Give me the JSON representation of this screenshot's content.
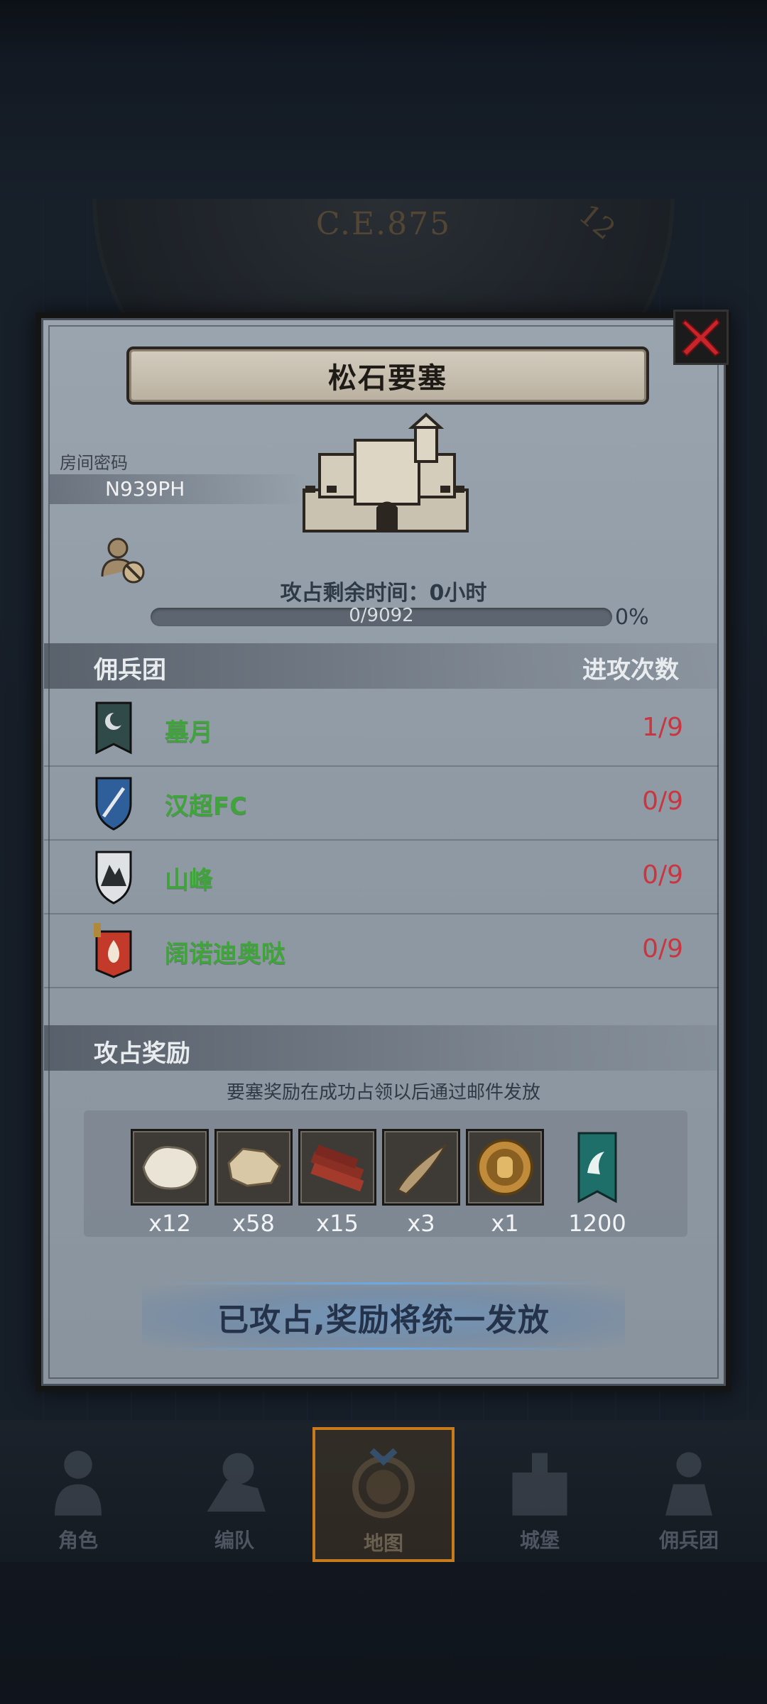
{
  "background": {
    "era_label": "C.E.875",
    "era_number": "12"
  },
  "fortress": {
    "title": "松石要塞",
    "room_label": "房间密码",
    "room_code": "N939PH",
    "timer_label": "攻占剩余时间：0小时",
    "progress_text": "0/9092",
    "progress_percent": "0%",
    "progress_fraction": 0
  },
  "mercenary_section": {
    "header_left": "佣兵团",
    "header_right": "进攻次数",
    "rows": [
      {
        "name": "墓月",
        "count": "1/9",
        "emblem": "moon-banner-icon"
      },
      {
        "name": "汉超FC",
        "count": "0/9",
        "emblem": "sword-shield-icon"
      },
      {
        "name": "山峰",
        "count": "0/9",
        "emblem": "mountain-shield-icon"
      },
      {
        "name": "阔诺迪奥哒",
        "count": "0/9",
        "emblem": "flame-banner-icon"
      }
    ]
  },
  "reward_section": {
    "header": "攻占奖励",
    "note": "要塞奖励在成功占领以后通过邮件发放",
    "items": [
      {
        "icon": "fur-pelt-icon",
        "qty": "x12"
      },
      {
        "icon": "leather-hide-icon",
        "qty": "x58"
      },
      {
        "icon": "wood-planks-icon",
        "qty": "x15"
      },
      {
        "icon": "horn-icon",
        "qty": "x3"
      },
      {
        "icon": "knight-medal-icon",
        "qty": "x1"
      },
      {
        "icon": "guild-banner-icon",
        "qty": "1200"
      }
    ]
  },
  "conquered_button": "已攻占,奖励将统一发放",
  "nav": {
    "items": [
      {
        "label": "角色",
        "icon": "character-icon"
      },
      {
        "label": "编队",
        "icon": "formation-icon"
      },
      {
        "label": "地图",
        "icon": "map-icon"
      },
      {
        "label": "城堡",
        "icon": "castle-icon"
      },
      {
        "label": "佣兵团",
        "icon": "mercenary-icon"
      }
    ],
    "active_index": 2
  },
  "colors": {
    "member_name": "#3fa53a",
    "attack_count": "#c9363f",
    "nav_active_border": "#c77b1c"
  }
}
